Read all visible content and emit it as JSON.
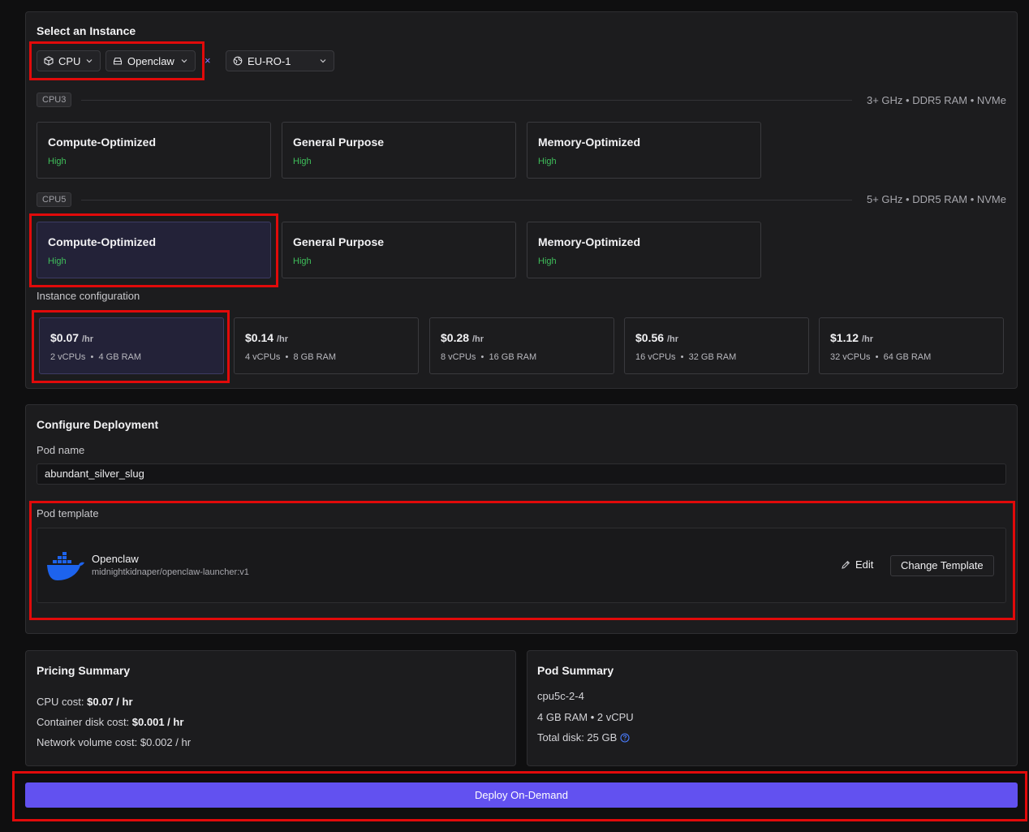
{
  "instance": {
    "title": "Select an Instance",
    "filters": {
      "type": "CPU",
      "template": "Openclaw",
      "clear": "×",
      "region": "EU-RO-1"
    },
    "sections": [
      {
        "tag": "CPU3",
        "spec": "3+ GHz • DDR5 RAM • NVMe",
        "cards": [
          {
            "name": "Compute-Optimized",
            "level": "High"
          },
          {
            "name": "General Purpose",
            "level": "High"
          },
          {
            "name": "Memory-Optimized",
            "level": "High"
          }
        ]
      },
      {
        "tag": "CPU5",
        "spec": "5+ GHz • DDR5 RAM • NVMe",
        "cards": [
          {
            "name": "Compute-Optimized",
            "level": "High"
          },
          {
            "name": "General Purpose",
            "level": "High"
          },
          {
            "name": "Memory-Optimized",
            "level": "High"
          }
        ]
      }
    ],
    "config_label": "Instance configuration",
    "configs": [
      {
        "price": "$0.07",
        "per": "/hr",
        "vcpus": "2 vCPUs",
        "ram": "4 GB RAM"
      },
      {
        "price": "$0.14",
        "per": "/hr",
        "vcpus": "4 vCPUs",
        "ram": "8 GB RAM"
      },
      {
        "price": "$0.28",
        "per": "/hr",
        "vcpus": "8 vCPUs",
        "ram": "16 GB RAM"
      },
      {
        "price": "$0.56",
        "per": "/hr",
        "vcpus": "16 vCPUs",
        "ram": "32 GB RAM"
      },
      {
        "price": "$1.12",
        "per": "/hr",
        "vcpus": "32 vCPUs",
        "ram": "64 GB RAM"
      }
    ]
  },
  "deployment": {
    "title": "Configure Deployment",
    "pod_name_label": "Pod name",
    "pod_name_value": "abundant_silver_slug",
    "template_label": "Pod template",
    "template_name": "Openclaw",
    "template_image": "midnightkidnaper/openclaw-launcher:v1",
    "edit_label": "Edit",
    "change_label": "Change Template"
  },
  "pricing": {
    "title": "Pricing Summary",
    "cpu_label": "CPU cost:",
    "cpu_value": "$0.07 / hr",
    "disk_label": "Container disk cost:",
    "disk_value": "$0.001 / hr",
    "network_label": "Network volume cost: $0.002 / hr"
  },
  "pod_summary": {
    "title": "Pod Summary",
    "id": "cpu5c-2-4",
    "resources": "4 GB RAM • 2 vCPU",
    "disk": "Total disk: 25 GB"
  },
  "deploy_label": "Deploy On-Demand",
  "colors": {
    "accent": "#6251f0",
    "highlight_box": "#e10a0a",
    "level_green": "#3fbf5b",
    "docker_blue": "#1d63ed"
  }
}
